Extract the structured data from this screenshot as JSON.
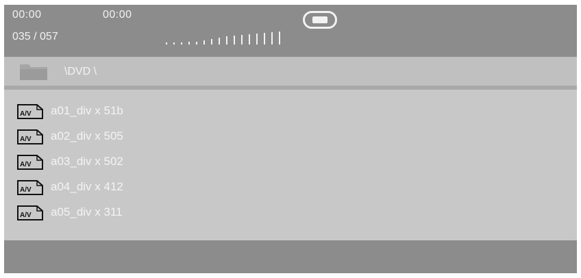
{
  "header": {
    "time_elapsed": "00:00",
    "time_total": "00:00",
    "track_counter": "035 / 057",
    "media_icon": "media-mode-icon",
    "volume_icon": "volume-level-icon"
  },
  "path_bar": {
    "folder_icon": "folder-icon",
    "path": "\\DVD \\"
  },
  "files": [
    {
      "name": "a01_div x 51b",
      "icon": "av-file-icon",
      "icon_label": "A/V"
    },
    {
      "name": "a02_div x 505",
      "icon": "av-file-icon",
      "icon_label": "A/V"
    },
    {
      "name": "a03_div x 502",
      "icon": "av-file-icon",
      "icon_label": "A/V"
    },
    {
      "name": "a04_div x 412",
      "icon": "av-file-icon",
      "icon_label": "A/V"
    },
    {
      "name": "a05_div x 311",
      "icon": "av-file-icon",
      "icon_label": "A/V"
    }
  ],
  "colors": {
    "screen_bg": "#c8c8c8",
    "header_bg": "#8c8c8c",
    "text": "#f4f4f4"
  }
}
